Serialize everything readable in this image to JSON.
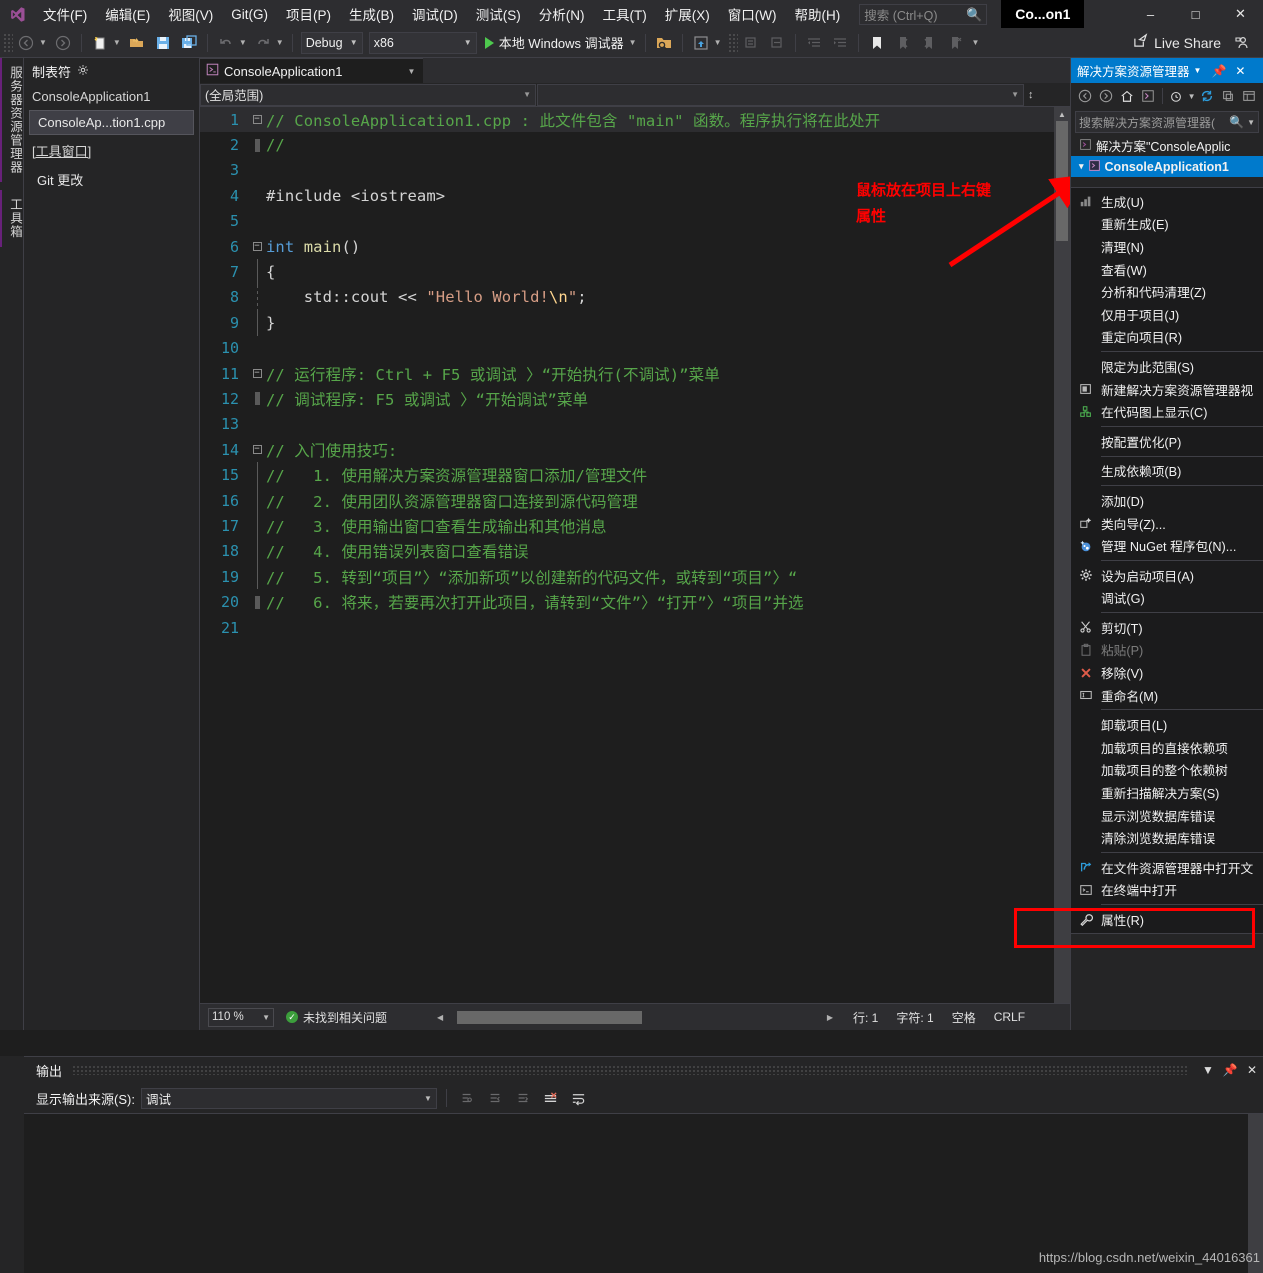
{
  "window": {
    "app_tab_label": "Co...on1",
    "minimize": "–",
    "maximize": "□",
    "close": "✕"
  },
  "menubar": {
    "items": [
      {
        "label": "文件(F)"
      },
      {
        "label": "编辑(E)"
      },
      {
        "label": "视图(V)"
      },
      {
        "label": "Git(G)"
      },
      {
        "label": "项目(P)"
      },
      {
        "label": "生成(B)"
      },
      {
        "label": "调试(D)"
      },
      {
        "label": "测试(S)"
      },
      {
        "label": "分析(N)"
      },
      {
        "label": "工具(T)"
      },
      {
        "label": "扩展(X)"
      },
      {
        "label": "窗口(W)"
      },
      {
        "label": "帮助(H)"
      }
    ],
    "search_placeholder": "搜索 (Ctrl+Q)"
  },
  "toolbar": {
    "config": "Debug",
    "platform": "x86",
    "run_label": "本地 Windows 调试器",
    "live_share": "Live Share"
  },
  "vertical_tabs": [
    {
      "label": "服务器资源管理器"
    },
    {
      "label": "工具箱"
    }
  ],
  "left_panel": {
    "header": "制表符",
    "group": "ConsoleApplication1",
    "selected_file": "ConsoleAp...tion1.cpp",
    "tool_window_group": "[工具窗口]",
    "tool_window_item": "Git 更改"
  },
  "editor": {
    "tab_label": "ConsoleApplication1",
    "scope_dropdown": "(全局范围)",
    "member_dropdown": "",
    "lines": [
      {
        "n": "1",
        "fold": "minus",
        "text": "// ConsoleApplication1.cpp : 此文件包含 \"main\" 函数。程序执行将在此处开",
        "kind": "comment",
        "highlight": true
      },
      {
        "n": "2",
        "fold": "end",
        "text": "//",
        "kind": "comment"
      },
      {
        "n": "3",
        "fold": "none",
        "text": "",
        "kind": "plain"
      },
      {
        "n": "4",
        "fold": "none",
        "text": "#include <iostream>",
        "kind": "pre"
      },
      {
        "n": "5",
        "fold": "none",
        "text": "",
        "kind": "plain"
      },
      {
        "n": "6",
        "fold": "minus",
        "text": "int main()",
        "kind": "func"
      },
      {
        "n": "7",
        "fold": "bar",
        "text": "{",
        "kind": "plain"
      },
      {
        "n": "8",
        "fold": "dash",
        "text": "    std::cout << \"Hello World!\\n\";",
        "kind": "cout"
      },
      {
        "n": "9",
        "fold": "bar",
        "text": "}",
        "kind": "plain"
      },
      {
        "n": "10",
        "fold": "none",
        "text": "",
        "kind": "plain"
      },
      {
        "n": "11",
        "fold": "minus",
        "text": "// 运行程序: Ctrl + F5 或调试 〉“开始执行(不调试)”菜单",
        "kind": "comment"
      },
      {
        "n": "12",
        "fold": "end",
        "text": "// 调试程序: F5 或调试 〉“开始调试”菜单",
        "kind": "comment"
      },
      {
        "n": "13",
        "fold": "none",
        "text": "",
        "kind": "plain"
      },
      {
        "n": "14",
        "fold": "minus",
        "text": "// 入门使用技巧:",
        "kind": "comment"
      },
      {
        "n": "15",
        "fold": "bar",
        "text": "//   1. 使用解决方案资源管理器窗口添加/管理文件",
        "kind": "comment"
      },
      {
        "n": "16",
        "fold": "bar",
        "text": "//   2. 使用团队资源管理器窗口连接到源代码管理",
        "kind": "comment"
      },
      {
        "n": "17",
        "fold": "bar",
        "text": "//   3. 使用输出窗口查看生成输出和其他消息",
        "kind": "comment"
      },
      {
        "n": "18",
        "fold": "bar",
        "text": "//   4. 使用错误列表窗口查看错误",
        "kind": "comment"
      },
      {
        "n": "19",
        "fold": "bar",
        "text": "//   5. 转到“项目”〉“添加新项”以创建新的代码文件，或转到“项目”〉“",
        "kind": "comment"
      },
      {
        "n": "20",
        "fold": "end",
        "text": "//   6. 将来，若要再次打开此项目，请转到“文件”〉“打开”〉“项目”并选",
        "kind": "comment"
      },
      {
        "n": "21",
        "fold": "none",
        "text": "",
        "kind": "plain"
      }
    ],
    "annotation_line1": "鼠标放在项目上右键",
    "annotation_line2": "属性"
  },
  "status_bar": {
    "zoom": "110 %",
    "issues": "未找到相关问题",
    "line": "行: 1",
    "char": "字符: 1",
    "spaces": "空格",
    "eol": "CRLF"
  },
  "solution_explorer": {
    "title": "解决方案资源管理器",
    "search_placeholder": "搜索解决方案资源管理器(",
    "solution_node": "解决方案\"ConsoleApplic",
    "project_node": "ConsoleApplication1"
  },
  "context_menu": {
    "items": [
      {
        "label": "生成(U)",
        "icon": "build-icon",
        "sep_after": false
      },
      {
        "label": "重新生成(E)",
        "icon": "",
        "sep_after": false
      },
      {
        "label": "清理(N)",
        "icon": "",
        "sep_after": false
      },
      {
        "label": "查看(W)",
        "icon": "",
        "sep_after": false
      },
      {
        "label": "分析和代码清理(Z)",
        "icon": "",
        "sep_after": false
      },
      {
        "label": "仅用于项目(J)",
        "icon": "",
        "sep_after": false
      },
      {
        "label": "重定向项目(R)",
        "icon": "",
        "sep_after": true
      },
      {
        "label": "限定为此范围(S)",
        "icon": "",
        "sep_after": false
      },
      {
        "label": "新建解决方案资源管理器视",
        "icon": "window-icon",
        "sep_after": false
      },
      {
        "label": "在代码图上显示(C)",
        "icon": "codemap-icon",
        "sep_after": true
      },
      {
        "label": "按配置优化(P)",
        "icon": "",
        "sep_after": true
      },
      {
        "label": "生成依赖项(B)",
        "icon": "",
        "sep_after": true
      },
      {
        "label": "添加(D)",
        "icon": "",
        "sep_after": false
      },
      {
        "label": "类向导(Z)...",
        "icon": "classwizard-icon",
        "sep_after": false
      },
      {
        "label": "管理 NuGet 程序包(N)...",
        "icon": "nuget-icon",
        "sep_after": true
      },
      {
        "label": "设为启动项目(A)",
        "icon": "gear-icon",
        "sep_after": false
      },
      {
        "label": "调试(G)",
        "icon": "",
        "sep_after": true
      },
      {
        "label": "剪切(T)",
        "icon": "scissors-icon",
        "sep_after": false
      },
      {
        "label": "粘贴(P)",
        "icon": "clipboard-icon",
        "disabled": true,
        "sep_after": false
      },
      {
        "label": "移除(V)",
        "icon": "x-icon",
        "sep_after": false
      },
      {
        "label": "重命名(M)",
        "icon": "rename-icon",
        "sep_after": true
      },
      {
        "label": "卸载项目(L)",
        "icon": "",
        "sep_after": false
      },
      {
        "label": "加载项目的直接依赖项",
        "icon": "",
        "sep_after": false
      },
      {
        "label": "加载项目的整个依赖树",
        "icon": "",
        "sep_after": false
      },
      {
        "label": "重新扫描解决方案(S)",
        "icon": "",
        "sep_after": false
      },
      {
        "label": "显示浏览数据库错误",
        "icon": "",
        "sep_after": false
      },
      {
        "label": "清除浏览数据库错误",
        "icon": "",
        "sep_after": true
      },
      {
        "label": "在文件资源管理器中打开文",
        "icon": "openfolder-icon",
        "sep_after": false
      },
      {
        "label": "在终端中打开",
        "icon": "terminal-icon",
        "sep_after": true
      },
      {
        "label": "属性(R)",
        "icon": "wrench-icon",
        "sep_after": false
      }
    ]
  },
  "output_panel": {
    "title": "输出",
    "source_label": "显示输出来源(S):",
    "source_value": "调试"
  },
  "watermark": "https://blog.csdn.net/weixin_44016361",
  "colors": {
    "accent": "#007acc",
    "annotation_red": "#ff0000",
    "comment_green": "#57a64a",
    "keyword_blue": "#569cd6",
    "string_orange": "#d69d85",
    "linenum_blue": "#2b91af",
    "chrome_bg": "#2d2d30",
    "editor_bg": "#1e1e1e"
  }
}
